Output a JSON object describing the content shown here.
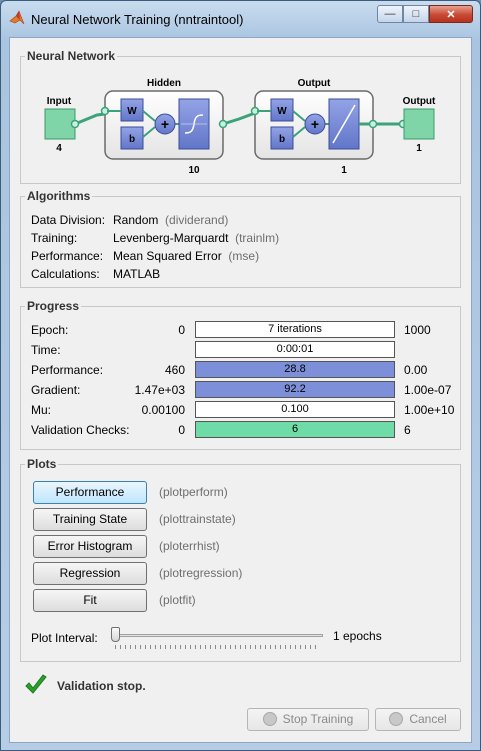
{
  "window": {
    "title": "Neural Network Training (nntraintool)",
    "controls": [
      "minimize",
      "maximize",
      "close"
    ]
  },
  "network": {
    "section_title": "Neural Network",
    "input": {
      "label": "Input",
      "size": "4"
    },
    "hidden": {
      "label": "Hidden",
      "size": "10",
      "w": "W",
      "b": "b"
    },
    "output_layer": {
      "label": "Output",
      "size": "1",
      "w": "W",
      "b": "b"
    },
    "output": {
      "label": "Output",
      "size": "1"
    },
    "colors": {
      "node_fill": "#7fd4a8",
      "block_fill": "#7d8fd9",
      "line": "#3aa37a"
    }
  },
  "algorithms": {
    "section_title": "Algorithms",
    "rows": [
      {
        "label": "Data Division:",
        "value": "Random",
        "fn": "(dividerand)"
      },
      {
        "label": "Training:",
        "value": "Levenberg-Marquardt",
        "fn": "(trainlm)"
      },
      {
        "label": "Performance:",
        "value": "Mean Squared Error",
        "fn": "(mse)"
      },
      {
        "label": "Calculations:",
        "value": "MATLAB",
        "fn": ""
      }
    ]
  },
  "progress": {
    "section_title": "Progress",
    "rows": [
      {
        "label": "Epoch:",
        "start": "0",
        "value": "7 iterations",
        "end": "1000",
        "fill": 0.0,
        "color": "#ffffff"
      },
      {
        "label": "Time:",
        "start": "",
        "value": "0:00:01",
        "end": "",
        "fill": 0.0,
        "color": "#ffffff"
      },
      {
        "label": "Performance:",
        "start": "460",
        "value": "28.8",
        "end": "0.00",
        "fill": 1.0,
        "color": "#7d8fd9"
      },
      {
        "label": "Gradient:",
        "start": "1.47e+03",
        "value": "92.2",
        "end": "1.00e-07",
        "fill": 1.0,
        "color": "#7d8fd9"
      },
      {
        "label": "Mu:",
        "start": "0.00100",
        "value": "0.100",
        "end": "1.00e+10",
        "fill": 0.0,
        "color": "#ffffff"
      },
      {
        "label": "Validation Checks:",
        "start": "0",
        "value": "6",
        "end": "6",
        "fill": 1.0,
        "color": "#6fdca8"
      }
    ]
  },
  "plots": {
    "section_title": "Plots",
    "buttons": [
      {
        "label": "Performance",
        "fn": "(plotperform)"
      },
      {
        "label": "Training State",
        "fn": "(plottrainstate)"
      },
      {
        "label": "Error Histogram",
        "fn": "(ploterrhist)"
      },
      {
        "label": "Regression",
        "fn": "(plotregression)"
      },
      {
        "label": "Fit",
        "fn": "(plotfit)"
      }
    ],
    "interval_label": "Plot Interval:",
    "interval_value": "1 epochs",
    "interval_slider_fraction": 0.0
  },
  "status": {
    "text": "Validation stop.",
    "color": "#2aa12a"
  },
  "footer": {
    "stop_label": "Stop Training",
    "cancel_label": "Cancel"
  }
}
